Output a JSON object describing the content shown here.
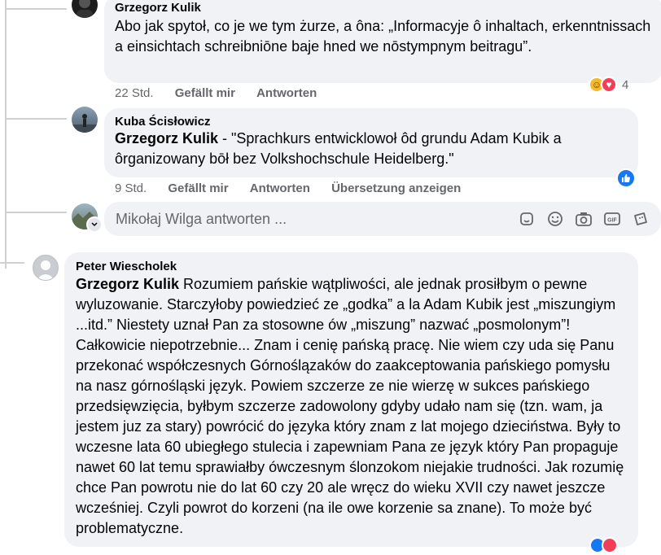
{
  "comments": [
    {
      "author": "Grzegorz Kulik",
      "text": "Abo jak spytoł, co je we tym żurze, a ôna: „Informacyje ô inhaltach, erkenntnissach a einsichtach schreibniōne baje hned we nōstympnym beitragu”.",
      "time": "22 Std.",
      "like_label": "Gefällt mir",
      "reply_label": "Antworten",
      "reaction_count": "4",
      "reactions": [
        "haha-icon",
        "love-icon"
      ]
    },
    {
      "author": "Kuba Ścisłowicz",
      "mention": "Grzegorz Kulik",
      "text": " - \"Sprachkurs entwicklowoł ôd grundu Adam Kubik a ôrganizowany bōł bez Volkshochschule Heidelberg.\"",
      "time": "9 Std.",
      "like_label": "Gefällt mir",
      "reply_label": "Antworten",
      "translate_label": "Übersetzung anzeigen",
      "reactions": [
        "like-icon"
      ]
    },
    {
      "author": "Peter Wiescholek",
      "mention": "Grzegorz Kulik",
      "text": " Rozumiem pańskie wątpliwości, ale jednak prosiłbym o pewne wyluzowanie. Starczyłoby powiedzieć ze „godka” a la Adam Kubik jest „miszungiym ...itd.” Niestety uznał Pan za stosowne ów „miszung” nazwać „posmolonym”! Całkowicie niepotrzebnie... Znam i cenię pańską pracę. Nie wiem czy uda się Panu przekonać współczesnych Górnoślązaków do zaakceptowania pańskiego pomysłu na nasz górnośląski język. Powiem szczerze ze nie wierzę w sukces pańskiego przedsięwzięcia, byłbym szczerze zadowolony gdyby udało nam się (tzn. wam, ja jestem juz za stary) powrócić do języka który znam z lat mojego dzieciństwa. Były to wczesne lata 60 ubiegłego stulecia i zapewniam Pana ze język który Pan propaguje nawet 60 lat temu sprawiałby ówczesnym ślonzokom niejakie trudności. Jak rozumię chce Pan powrotu nie do lat 60 czy 20 ale wręcz do wieku XVII czy nawet jeszcze wcześniej. Czyli powrot do korzeni (na ile owe korzenie sa znane). To może być problematyczne."
    }
  ],
  "reply_box": {
    "placeholder": "Mikołaj Wilga antworten ...",
    "tools": [
      "sticker-icon",
      "emoji-icon",
      "camera-icon",
      "gif-icon",
      "sticker-pack-icon"
    ]
  },
  "colors": {
    "bubble": "#f0f2f5",
    "meta_text": "#65676b",
    "like_blue": "#1877f2",
    "love_red": "#f33e58",
    "haha_yellow": "#f7b928"
  }
}
